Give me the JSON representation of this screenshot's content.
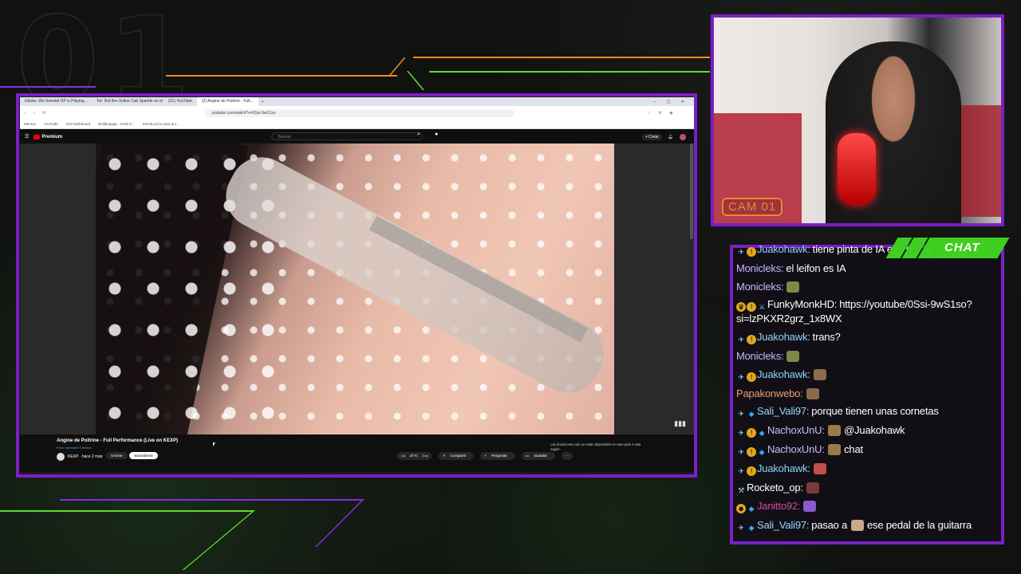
{
  "overlay": {
    "cam_label": "CAM 01",
    "chat_label": "CHAT",
    "colors": {
      "accent": "#7a1fc7",
      "green": "#3ecf21",
      "orange": "#e98a2a"
    }
  },
  "browser": {
    "tabs": [
      "Gitiote: We Remind OP is Playing...",
      "Tor: Rot the Online Cab Sparkle on el E...",
      "(21) YouTube",
      "(2) Angine de Poitrine - Full...",
      "+"
    ],
    "url": "youtube.com/watch?v=0Ssi-9wS1so",
    "bookmarks": [
      "Mensur",
      "YouTube",
      "Get Dashboard",
      "Buildingapp - Kraft G...",
      "Introducción para pro..."
    ],
    "youtube": {
      "logo": "Premium",
      "search_placeholder": "Buscar",
      "create": "Crear",
      "video_title": "Angine de Poitrine - Full Performance (Live on KEXP)",
      "video_sub": "Price estimated Timeline",
      "channel": "KEXP",
      "channel_meta": "hace 2 más",
      "join": "Unirme",
      "subscribe": "Suscribirme",
      "likes": "37 K",
      "share": "Compartir",
      "ask": "Preguntar",
      "save": "Guardar",
      "more": "···",
      "donations": "Las donaciones aún no están disponibles en este país o esta región."
    }
  },
  "chat": [
    {
      "badges": [
        "sword",
        "gold"
      ],
      "name": "Juakohawk",
      "color": "#8fd4ff",
      "text": "tiene pinta de IA eso si"
    },
    {
      "badges": [],
      "name": "Monicleks",
      "color": "#c9b8ff",
      "text": "el leifon es IA"
    },
    {
      "badges": [],
      "name": "Monicleks",
      "color": "#c9b8ff",
      "text": "",
      "emote": "#7a8a4a"
    },
    {
      "badges": [
        "crown",
        "gold",
        "mod"
      ],
      "name": "FunkyMonkHD",
      "color": "#ffffff",
      "text": "https://youtube/0Ssi-9wS1so?si=lzPKXR2grz_1x8WX"
    },
    {
      "badges": [
        "sword",
        "gold"
      ],
      "name": "Juakohawk",
      "color": "#8fd4ff",
      "text": "trans?"
    },
    {
      "badges": [],
      "name": "Monicleks",
      "color": "#c9b8ff",
      "text": "",
      "emote": "#7a8a4a"
    },
    {
      "badges": [
        "sword",
        "gold"
      ],
      "name": "Juakohawk",
      "color": "#8fd4ff",
      "text": "",
      "emote": "#8a6b4a"
    },
    {
      "badges": [],
      "name": "Papakonwebo",
      "color": "#e8a070",
      "text": "",
      "emote": "#8a6b4a"
    },
    {
      "badges": [
        "sword",
        "cube"
      ],
      "name": "Sali_Vali97",
      "color": "#9ad7ff",
      "text": "porque tienen unas cornetas"
    },
    {
      "badges": [
        "sword",
        "gold",
        "cube"
      ],
      "name": "NachoxUnU",
      "color": "#c9b8ff",
      "text": "@Juakohawk",
      "emote": "#9a7a4a"
    },
    {
      "badges": [
        "sword",
        "gold",
        "cube"
      ],
      "name": "NachoxUnU",
      "color": "#c9b8ff",
      "text": "chat",
      "emote": "#9a7a4a"
    },
    {
      "badges": [
        "sword",
        "gold"
      ],
      "name": "Juakohawk",
      "color": "#8fd4ff",
      "text": "",
      "emote": "#c0504a"
    },
    {
      "badges": [
        "tool"
      ],
      "name": "Rocketo_op",
      "color": "#ffffff",
      "text": "",
      "emote": "#7a3a3a"
    },
    {
      "badges": [
        "smile",
        "cube"
      ],
      "name": "Janitto92",
      "color": "#d04aa0",
      "text": "",
      "emote": "#8a5ad0"
    },
    {
      "badges": [
        "sword",
        "cube"
      ],
      "name": "Sali_Vali97",
      "color": "#9ad7ff",
      "text": "pasao a",
      "emote": "#c9a88a",
      "text2": "ese pedal de la guitarra"
    }
  ]
}
